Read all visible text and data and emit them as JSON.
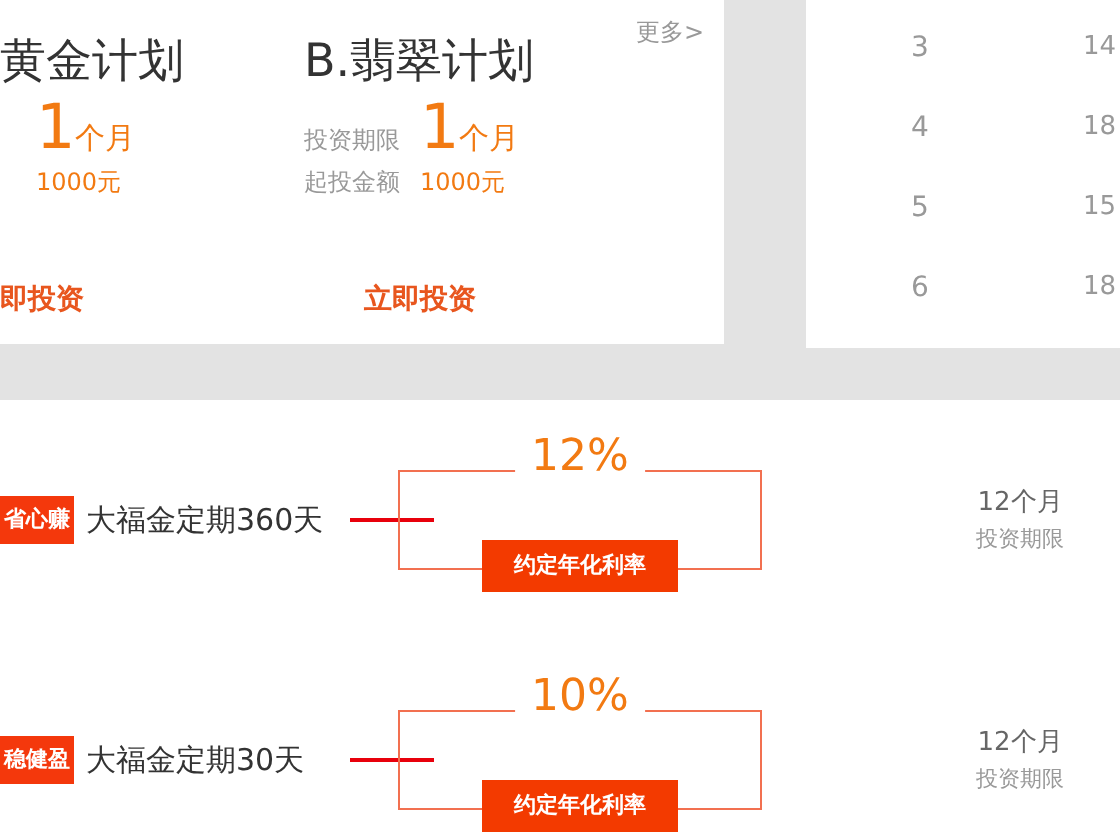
{
  "plans": [
    {
      "title": "黄金计划",
      "term": {
        "value": "1",
        "unit": "个月"
      },
      "amount": {
        "value": "1000元"
      },
      "button": "即投资"
    },
    {
      "title": "B.翡翠计划",
      "term": {
        "label": "投资期限",
        "value": "1",
        "unit": "个月"
      },
      "amount": {
        "label": "起投金额",
        "value": "1000元"
      },
      "button": "立即投资"
    }
  ],
  "more_link": "更多>",
  "side_table": {
    "rows": [
      [
        "3",
        "14"
      ],
      [
        "4",
        "18"
      ],
      [
        "5",
        "15"
      ],
      [
        "6",
        "18"
      ]
    ]
  },
  "products": [
    {
      "tag": "省心赚",
      "name": "大福金定期360天",
      "rate": "12%",
      "rate_label": "约定年化利率",
      "term": "12个月",
      "term_label": "投资期限"
    },
    {
      "tag": "稳健盈",
      "name": "大福金定期30天",
      "rate": "10%",
      "rate_label": "约定年化利率",
      "term": "12个月",
      "term_label": "投资期限"
    }
  ]
}
